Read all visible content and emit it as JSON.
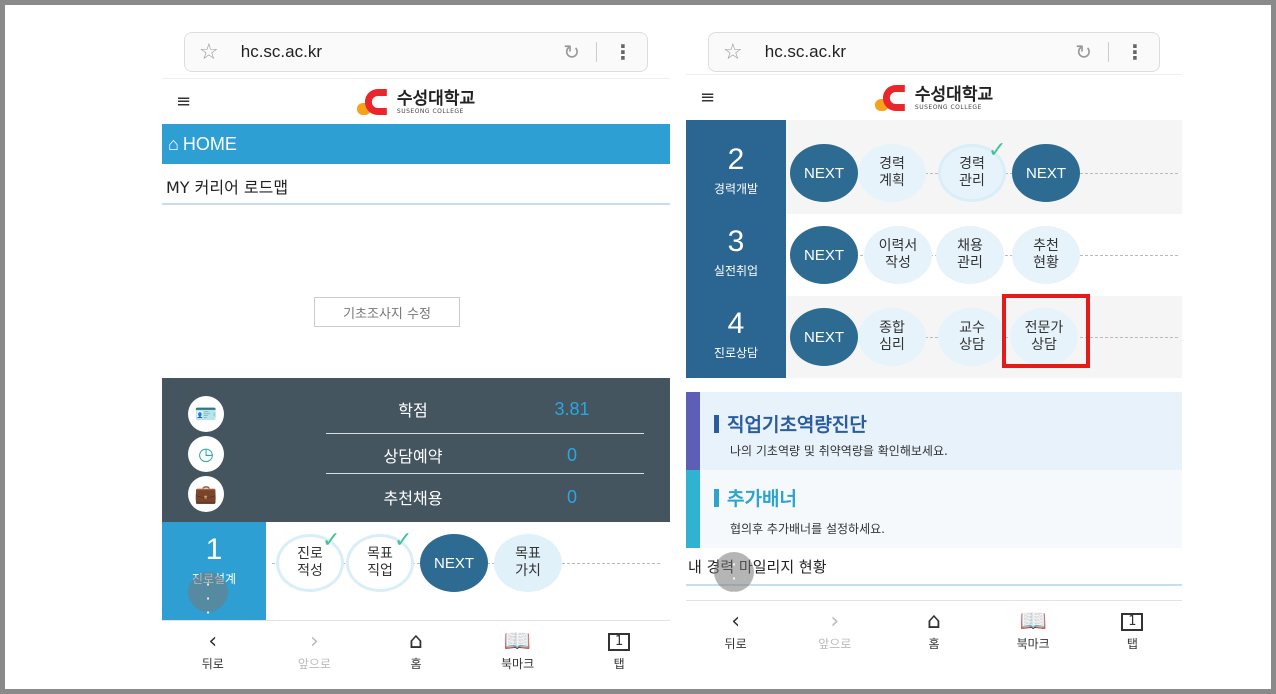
{
  "left": {
    "url": "hc.sc.ac.kr",
    "logo": {
      "ko": "수성대학교",
      "en": "SUSEONG COLLEGE"
    },
    "home_label": "HOME",
    "roadmap_title": "MY 커리어 로드맵",
    "edit_button": "기초조사지 수정",
    "stats": [
      {
        "label": "학점",
        "value": "3.81",
        "icon": "id-card-icon"
      },
      {
        "label": "상담예약",
        "value": "0",
        "icon": "clock-icon"
      },
      {
        "label": "추천채용",
        "value": "0",
        "icon": "briefcase-icon"
      }
    ],
    "step1": {
      "number": "1",
      "title": "진로설계",
      "items": [
        {
          "label": "진로\n적성",
          "done": true
        },
        {
          "label": "목표\n직업",
          "done": true
        },
        {
          "label": "NEXT",
          "next": true
        },
        {
          "label": "목표\n가치"
        }
      ]
    },
    "nav": {
      "back": "뒤로",
      "forward": "앞으로",
      "home": "홈",
      "bookmark": "북마크",
      "tabs": "탭",
      "tab_count": "1"
    }
  },
  "right": {
    "url": "hc.sc.ac.kr",
    "logo": {
      "ko": "수성대학교",
      "en": "SUSEONG COLLEGE"
    },
    "steps": [
      {
        "number": "2",
        "title": "경력개발",
        "items": [
          {
            "label": "NEXT",
            "next": true
          },
          {
            "label": "경력\n계획"
          },
          {
            "label": "경력\n관리",
            "done": true
          },
          {
            "label": "NEXT",
            "next": true
          }
        ]
      },
      {
        "number": "3",
        "title": "실전취업",
        "items": [
          {
            "label": "NEXT",
            "next": true
          },
          {
            "label": "이력서\n작성"
          },
          {
            "label": "채용\n관리"
          },
          {
            "label": "추천\n현황"
          }
        ]
      },
      {
        "number": "4",
        "title": "진로상담",
        "items": [
          {
            "label": "NEXT",
            "next": true
          },
          {
            "label": "종합\n심리"
          },
          {
            "label": "교수\n상담"
          },
          {
            "label": "전문가\n상담",
            "highlighted": true
          }
        ]
      }
    ],
    "banner1": {
      "title": "직업기초역량진단",
      "subtitle": "나의 기초역량 및 취약역량을 확인해보세요."
    },
    "banner2": {
      "title": "추가배너",
      "subtitle": "협의후 추가배너를 설정하세요."
    },
    "mileage_title": "내 경력 마일리지 현황",
    "nav": {
      "back": "뒤로",
      "forward": "앞으로",
      "home": "홈",
      "bookmark": "북마크",
      "tabs": "탭",
      "tab_count": "1"
    }
  },
  "colors": {
    "accent_blue": "#2d9fd3",
    "dark_panel": "#455560",
    "next_circle": "#2e6b92",
    "highlight_red": "#e51a1a",
    "check_green": "#41c39a"
  }
}
